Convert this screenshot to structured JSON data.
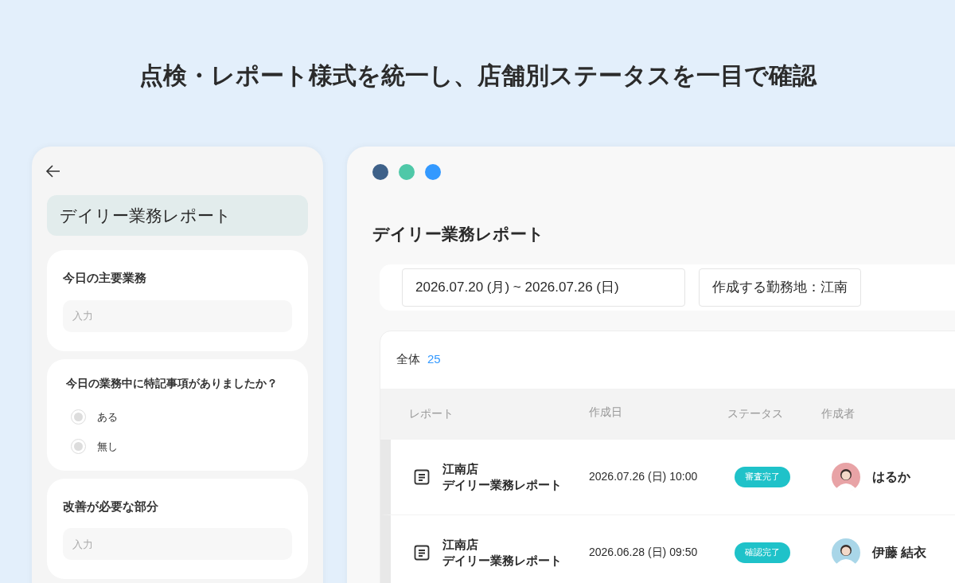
{
  "headline": "点検・レポート様式を統一し、店舗別ステータスを一目で確認",
  "form": {
    "title": "デイリー業務レポート",
    "sections": [
      {
        "kind": "text",
        "label": "今日の主要業務",
        "placeholder": "入力"
      },
      {
        "kind": "radio",
        "label": "今日の業務中に特記事項がありましたか？",
        "options": [
          {
            "label": "ある",
            "selected": false
          },
          {
            "label": "無し",
            "selected": false
          }
        ]
      },
      {
        "kind": "text",
        "label": "改善が必要な部分",
        "placeholder": "入力"
      }
    ]
  },
  "dashboard": {
    "window_dots": [
      {
        "color": "#3e6189"
      },
      {
        "color": "#4fc8a8"
      },
      {
        "color": "#3399ff"
      }
    ],
    "title": "デイリー業務レポート",
    "filters": [
      "2026.07.20 (月) ~ 2026.07.26 (日)",
      "作成する勤務地：江南"
    ],
    "table": {
      "total_label": "全体",
      "total_count": "25",
      "columns": [
        "レポート",
        "作成日",
        "ステータス",
        "作成者"
      ],
      "rows": [
        {
          "store": "江南店",
          "report": "デイリー業務レポート",
          "date": "2026.07.26 (日) 10:00",
          "status": "審査完了",
          "author": "はるか",
          "color": "#e8a3a6"
        },
        {
          "store": "江南店",
          "report": "デイリー業務レポート",
          "date": "2026.06.28 (日) 09:50",
          "status": "確認完了",
          "author": "伊藤 結衣",
          "color": "#a9d6e8"
        }
      ]
    }
  }
}
